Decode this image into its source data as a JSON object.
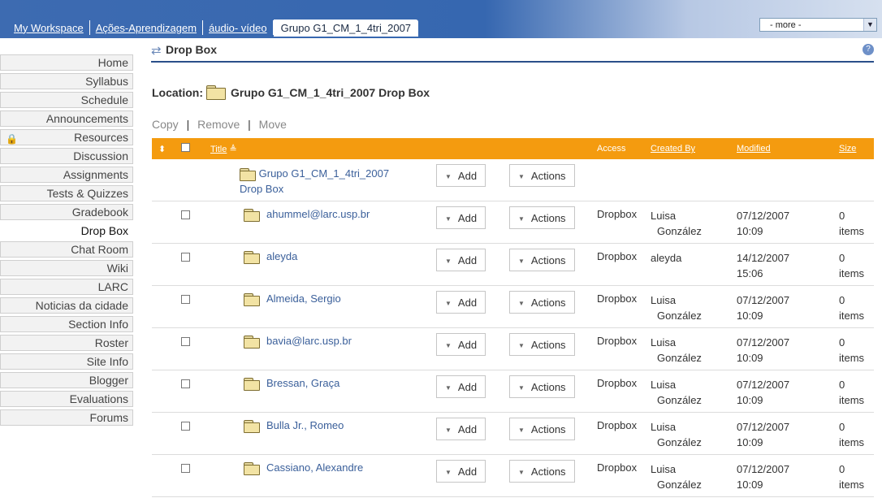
{
  "topbar": {
    "tabs": [
      "My Workspace",
      "Ações-Aprendizagem",
      "áudio- vídeo"
    ],
    "current_site": "Grupo G1_CM_1_4tri_2007",
    "more_select": "- more -"
  },
  "nav": {
    "items": [
      {
        "label": "Home"
      },
      {
        "label": "Syllabus"
      },
      {
        "label": "Schedule"
      },
      {
        "label": "Announcements"
      },
      {
        "label": "Resources",
        "icon": "lock-icon"
      },
      {
        "label": "Discussion"
      },
      {
        "label": "Assignments"
      },
      {
        "label": "Tests & Quizzes"
      },
      {
        "label": "Gradebook"
      },
      {
        "label": "Drop Box",
        "current": true
      },
      {
        "label": "Chat Room"
      },
      {
        "label": "Wiki"
      },
      {
        "label": "LARC"
      },
      {
        "label": "Noticias da cidade"
      },
      {
        "label": "Section Info"
      },
      {
        "label": "Roster"
      },
      {
        "label": "Site Info"
      },
      {
        "label": "Blogger"
      },
      {
        "label": "Evaluations"
      },
      {
        "label": "Forums"
      }
    ]
  },
  "tool": {
    "title": "Drop Box",
    "location_label": "Location:",
    "location_value": "Grupo G1_CM_1_4tri_2007 Drop Box"
  },
  "actions": {
    "copy": "Copy",
    "remove": "Remove",
    "move": "Move",
    "sep": "|"
  },
  "table": {
    "headers": {
      "title": "Title",
      "access": "Access",
      "created_by": "Created By",
      "modified": "Modified",
      "size": "Size"
    },
    "add_label": "Add",
    "actions_label": "Actions",
    "root": {
      "line1": "Grupo G1_CM_1_4tri_2007",
      "line2": "Drop Box"
    },
    "rows": [
      {
        "title": "ahummel@larc.usp.br",
        "access": "Dropbox",
        "created_by_1": "Luisa",
        "created_by_2": "González",
        "date": "07/12/2007",
        "time": "10:09",
        "size_1": "0",
        "size_2": "items"
      },
      {
        "title": "aleyda",
        "access": "Dropbox",
        "created_by_1": "aleyda",
        "created_by_2": "",
        "date": "14/12/2007",
        "time": "15:06",
        "size_1": "0",
        "size_2": "items"
      },
      {
        "title": "Almeida, Sergio",
        "access": "Dropbox",
        "created_by_1": "Luisa",
        "created_by_2": "González",
        "date": "07/12/2007",
        "time": "10:09",
        "size_1": "0",
        "size_2": "items"
      },
      {
        "title": "bavia@larc.usp.br",
        "access": "Dropbox",
        "created_by_1": "Luisa",
        "created_by_2": "González",
        "date": "07/12/2007",
        "time": "10:09",
        "size_1": "0",
        "size_2": "items"
      },
      {
        "title": "Bressan, Graça",
        "access": "Dropbox",
        "created_by_1": "Luisa",
        "created_by_2": "González",
        "date": "07/12/2007",
        "time": "10:09",
        "size_1": "0",
        "size_2": "items"
      },
      {
        "title": "Bulla Jr., Romeo",
        "access": "Dropbox",
        "created_by_1": "Luisa",
        "created_by_2": "González",
        "date": "07/12/2007",
        "time": "10:09",
        "size_1": "0",
        "size_2": "items"
      },
      {
        "title": "Cassiano, Alexandre",
        "access": "Dropbox",
        "created_by_1": "Luisa",
        "created_by_2": "González",
        "date": "07/12/2007",
        "time": "10:09",
        "size_1": "0",
        "size_2": "items"
      }
    ]
  }
}
